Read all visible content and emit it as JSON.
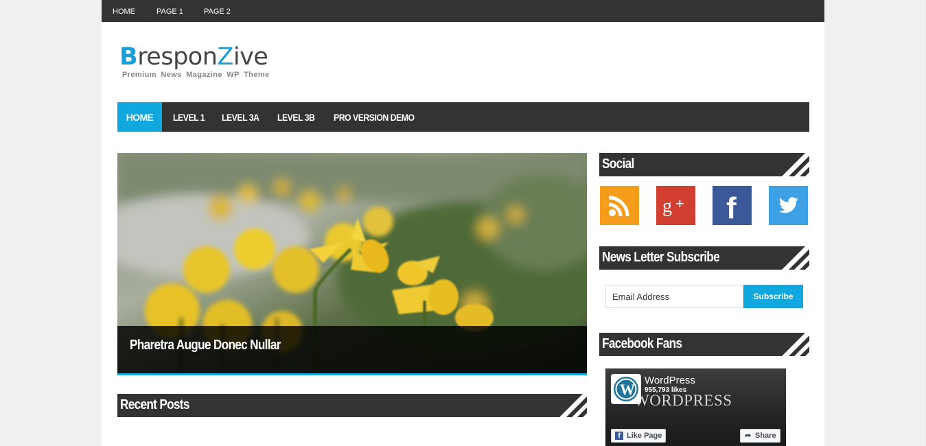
{
  "topnav": {
    "items": [
      "HOME",
      "PAGE 1",
      "PAGE 2"
    ]
  },
  "logo": {
    "title_part1": "B",
    "title_part2": "respon",
    "title_part3": "Z",
    "title_part4": "ive",
    "tagline": "Premium News Magazine WP Theme"
  },
  "mainnav": {
    "items": [
      "HOME",
      "LEVEL 1",
      "LEVEL 3A",
      "LEVEL 3B",
      "PRO VERSION DEMO"
    ],
    "active_index": 0
  },
  "featured": {
    "caption": "Pharetra Augue Donec Nullar"
  },
  "recent_posts": {
    "title": "Recent Posts"
  },
  "sidebar": {
    "social": {
      "title": "Social",
      "icons": [
        "rss-icon",
        "google-plus-icon",
        "facebook-icon",
        "twitter-icon"
      ]
    },
    "newsletter": {
      "title": "News Letter Subscribe",
      "email_value": "Email Address",
      "button_label": "Subscribe"
    },
    "facebook_fans": {
      "title": "Facebook Fans",
      "page_name": "WordPress",
      "likes": "955,793 likes",
      "cover_text": "WORDPRESS",
      "like_label": "Like Page",
      "share_label": "Share"
    }
  },
  "colors": {
    "accent": "#11a7df",
    "dark": "#333333",
    "rss": "#f59d1b",
    "google_plus": "#d23e2f",
    "facebook": "#3b5998",
    "twitter": "#3ea0e5"
  }
}
